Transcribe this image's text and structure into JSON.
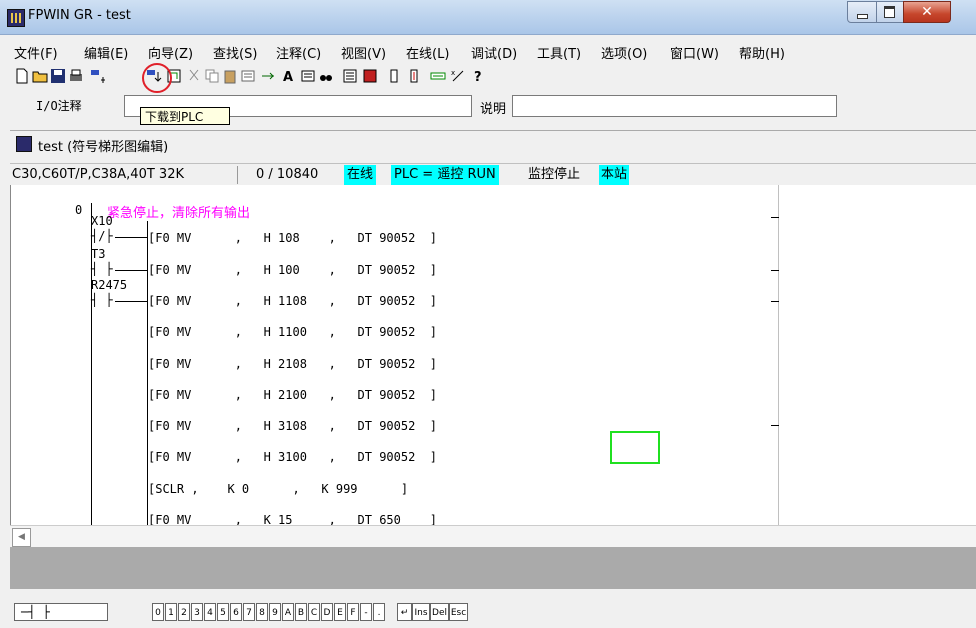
{
  "window": {
    "title": "FPWIN GR - test"
  },
  "menu": [
    "文件(F)",
    "编辑(E)",
    "向导(Z)",
    "查找(S)",
    "注释(C)",
    "视图(V)",
    "在线(L)",
    "调试(D)",
    "工具(T)",
    "选项(O)",
    "窗口(W)",
    "帮助(H)"
  ],
  "io_row": {
    "io_label": "I/O注释",
    "desc_label": "说明",
    "io_value": "",
    "desc_value": ""
  },
  "tooltip": "下载到PLC",
  "child_window": {
    "title": "test (符号梯形图编辑)"
  },
  "status": {
    "model": "C30,C60T/P,C38A,40T 32K",
    "steps": "0 / 10840",
    "online": "在线",
    "plc_mode": "PLC = 遥控 RUN",
    "monitor": "监控停止",
    "station": "本站"
  },
  "ladder": {
    "step": "0",
    "comment": "紧急停止，清除所有输出",
    "contacts": [
      "X10",
      "T3",
      "R2475"
    ],
    "instructions": [
      "[F0 MV      ,   H 108    ,   DT 90052  ]",
      "[F0 MV      ,   H 100    ,   DT 90052  ]",
      "[F0 MV      ,   H 1108   ,   DT 90052  ]",
      "[F0 MV      ,   H 1100   ,   DT 90052  ]",
      "[F0 MV      ,   H 2108   ,   DT 90052  ]",
      "[F0 MV      ,   H 2100   ,   DT 90052  ]",
      "[F0 MV      ,   H 3108   ,   DT 90052  ]",
      "[F0 MV      ,   H 3100   ,   DT 90052  ]",
      "[SCLR ,    K 0      ,   K 999      ]",
      "[F0 MV      ,   K 15     ,   DT 650    ]"
    ]
  },
  "keypad": [
    "0",
    "1",
    "2",
    "3",
    "4",
    "5",
    "6",
    "7",
    "8",
    "9",
    "A",
    "B",
    "C",
    "D",
    "E",
    "F",
    "-",
    "."
  ],
  "keypad_extra": [
    "Ins",
    "Del",
    "Esc"
  ],
  "colors": {
    "online_bg": "#00ffff",
    "comment": "#ff00ff",
    "highlight": "#e0202a",
    "cursor": "#20e020"
  }
}
